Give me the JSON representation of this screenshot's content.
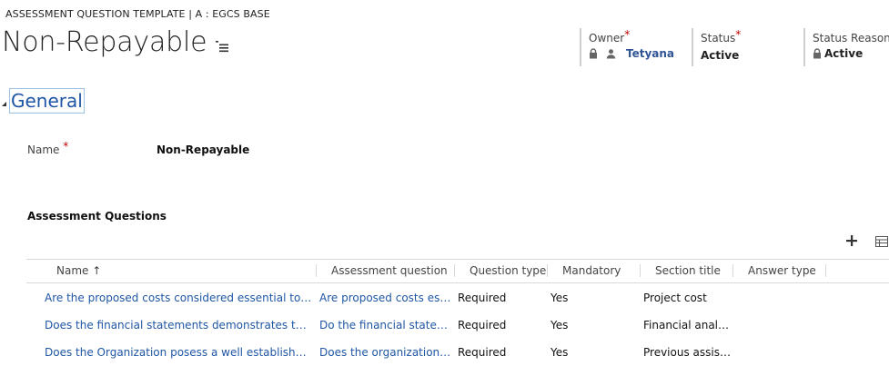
{
  "header": {
    "breadcrumb": "ASSESSMENT QUESTION TEMPLATE | A : EGCS BASE",
    "title": "Non-Repayable",
    "owner": {
      "label": "Owner",
      "required": "*",
      "value": "Tetyana"
    },
    "status": {
      "label": "Status",
      "required": "*",
      "value": "Active"
    },
    "status_reason": {
      "label": "Status Reason",
      "value": "Active"
    }
  },
  "section": {
    "title": "General"
  },
  "fields": {
    "name": {
      "label": "Name",
      "required": "*",
      "value": "Non-Repayable"
    }
  },
  "subgrid": {
    "title": "Assessment Questions",
    "columns": [
      "Name ↑",
      "Assessment question",
      "Question type",
      "Mandatory",
      "Section title",
      "Answer type"
    ],
    "rows": [
      {
        "name": "Are the proposed costs considered essential to the pr...",
        "question": "Are proposed costs essen...",
        "type": "Required",
        "mandatory": "Yes",
        "section": "Project cost",
        "answer": ""
      },
      {
        "name": "Does the financial statements demonstrates the orga...",
        "question": "Do the financial statemen...",
        "type": "Required",
        "mandatory": "Yes",
        "section": "Financial analysis",
        "answer": ""
      },
      {
        "name": "Does the Organization posess a well established boar...",
        "question": "Does the organization po...",
        "type": "Required",
        "mandatory": "Yes",
        "section": "Previous assista...",
        "answer": ""
      }
    ]
  },
  "icons": {
    "title_menu": "list-menu-icon",
    "lock": "lock-icon",
    "user": "user-icon",
    "add": "plus-icon",
    "view": "grid-view-icon"
  },
  "colors": {
    "link": "#1f56a5",
    "required": "#c00000"
  }
}
